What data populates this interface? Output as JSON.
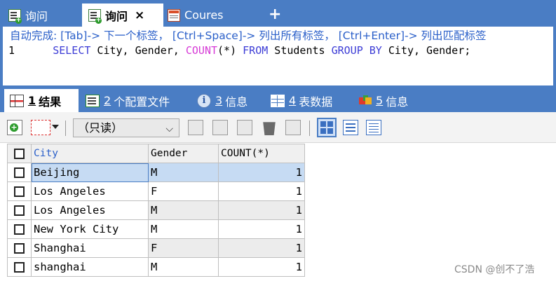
{
  "tabs": [
    {
      "label": "询问",
      "icon": "query-icon",
      "active": false
    },
    {
      "label": "询问",
      "icon": "query-icon",
      "active": true,
      "close": "×"
    },
    {
      "label": "Coures",
      "icon": "table-design-icon",
      "active": false
    }
  ],
  "new_tab_label": "+",
  "editor": {
    "hint": "自动完成: [Tab]-> 下一个标签， [Ctrl+Space]-> 列出所有标签， [Ctrl+Enter]-> 列出匹配标签",
    "line_number": "1",
    "sql": {
      "k1": "SELECT",
      "t1": " City, Gender, ",
      "f1": "COUNT",
      "t2": "(*) ",
      "k2": "FROM",
      "t3": " Students ",
      "k3": "GROUP BY",
      "t4": " City, Gender;"
    }
  },
  "result_tabs": [
    {
      "num": "1",
      "label": "结果",
      "icon": "result-grid-icon",
      "active": true
    },
    {
      "num": "2",
      "label": "个配置文件",
      "icon": "profile-icon"
    },
    {
      "num": "3",
      "label": "信息",
      "icon": "info-icon",
      "glyph": "i"
    },
    {
      "num": "4",
      "label": "表数据",
      "icon": "table-data-icon"
    },
    {
      "num": "5",
      "label": "信息",
      "icon": "status-icon"
    }
  ],
  "toolbar": {
    "mode_value": "（只读）",
    "mode_arrow": "⌵"
  },
  "grid": {
    "columns": [
      "City",
      "Gender",
      "COUNT(*)"
    ],
    "rows": [
      {
        "city": "Beijing",
        "gender": "M",
        "count": "1"
      },
      {
        "city": "Los Angeles",
        "gender": "F",
        "count": "1"
      },
      {
        "city": "Los Angeles",
        "gender": "M",
        "count": "1"
      },
      {
        "city": "New York City",
        "gender": "M",
        "count": "1"
      },
      {
        "city": "Shanghai",
        "gender": "F",
        "count": "1"
      },
      {
        "city": "shanghai",
        "gender": "M",
        "count": "1"
      }
    ]
  },
  "watermark": "CSDN @创不了浩",
  "colors": {
    "accent": "#4a7dc4",
    "hint": "#2a5fc9",
    "keyword": "#3c3cd6",
    "function": "#d63ad6",
    "selection": "#c6dbf3"
  }
}
